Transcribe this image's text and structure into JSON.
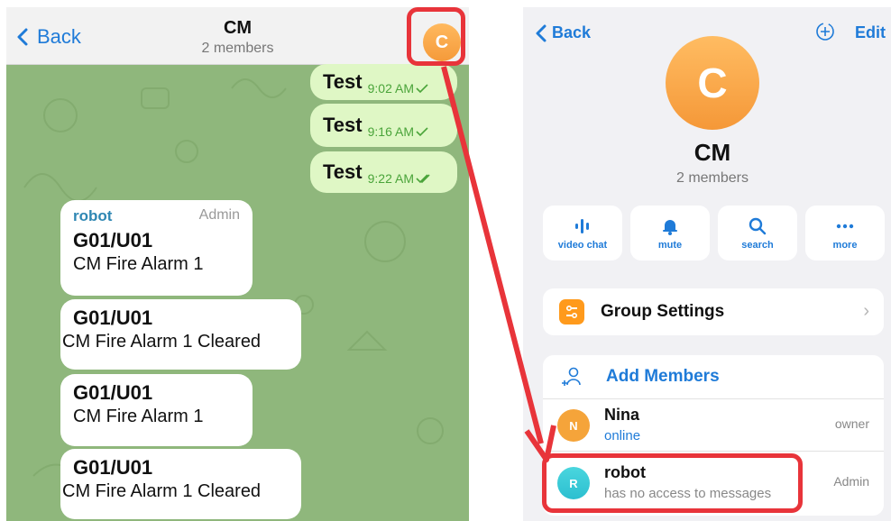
{
  "chat": {
    "back_label": "Back",
    "title": "CM",
    "subtitle": "2 members",
    "avatar_letter": "C",
    "outgoing": [
      {
        "text": "Test",
        "time": "9:02 AM"
      },
      {
        "text": "Test",
        "time": "9:16 AM"
      },
      {
        "text": "Test",
        "time": "9:22 AM"
      }
    ],
    "incoming": [
      {
        "sender": "robot",
        "role": "Admin",
        "line1": "G01/U01",
        "line2": "CM Fire Alarm 1"
      },
      {
        "line1": "G01/U01",
        "line2": "CM Fire Alarm 1 Cleared"
      },
      {
        "line1": "G01/U01",
        "line2": "CM Fire Alarm 1"
      },
      {
        "line1": "G01/U01",
        "line2": "CM Fire Alarm 1 Cleared"
      }
    ]
  },
  "info": {
    "back_label": "Back",
    "edit_label": "Edit",
    "avatar_letter": "C",
    "title": "CM",
    "subtitle": "2 members",
    "actions": [
      {
        "label": "video chat",
        "icon": "video-chat-icon"
      },
      {
        "label": "mute",
        "icon": "bell-icon"
      },
      {
        "label": "search",
        "icon": "search-icon"
      },
      {
        "label": "more",
        "icon": "more-icon"
      }
    ],
    "group_settings_label": "Group Settings",
    "add_members_label": "Add Members",
    "members": [
      {
        "initial": "N",
        "name": "Nina",
        "status": "online",
        "role": "owner",
        "status_color": "#1f7bd8",
        "avatar_color": "#f5a43a"
      },
      {
        "initial": "R",
        "name": "robot",
        "status": "has no access to messages",
        "role": "Admin",
        "status_color": "#888888",
        "avatar_color": "#38c8d6"
      }
    ]
  },
  "colors": {
    "accent": "#1f7bd8",
    "highlight": "#e8343a",
    "outgoing_bubble": "#dff7c5"
  }
}
